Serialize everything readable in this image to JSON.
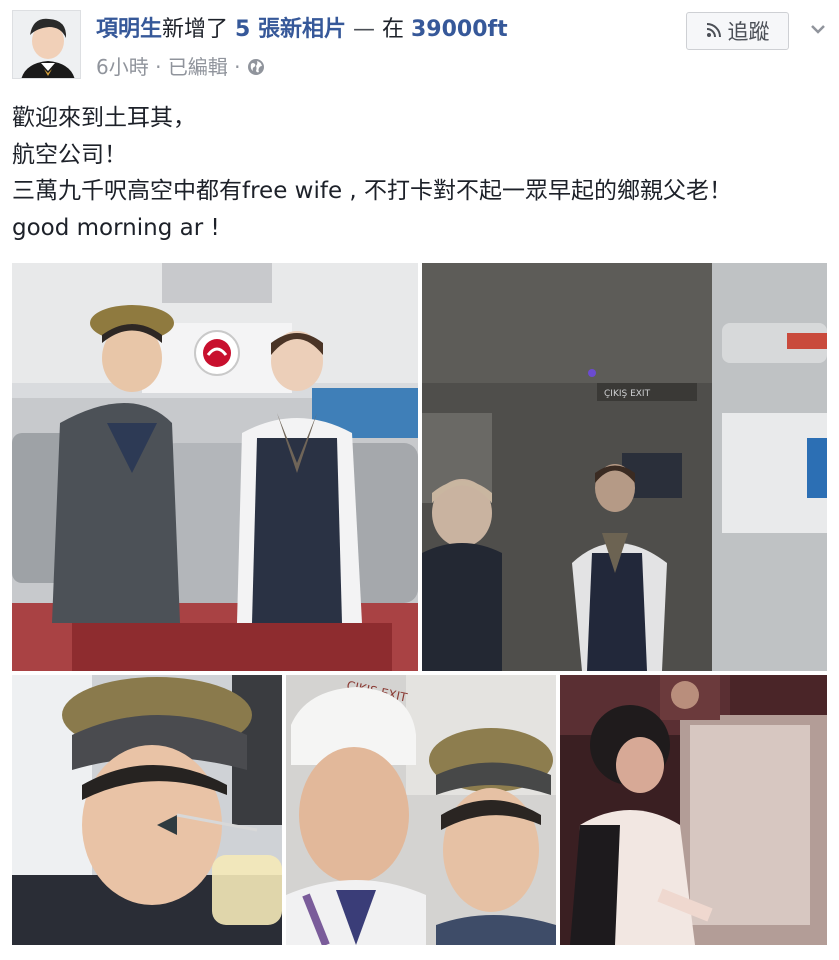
{
  "post": {
    "author": "項明生",
    "verb": "新增了",
    "photo_count_text": "5 張新相片",
    "dash": " — ",
    "at_text": "在 ",
    "place": "39000ft",
    "time": "6小時",
    "sep1": " · ",
    "edited": "已編輯",
    "sep2": " · ",
    "follow_label": "追蹤",
    "message_lines": [
      "歡迎來到土耳其，",
      "航空公司！",
      "三萬九千呎高空中都有free wife , 不打卡對不起一眾早起的鄉親父老！",
      "good morning ar !"
    ]
  },
  "photos": [
    {
      "id": "cabin-portrait",
      "overlay_text": ""
    },
    {
      "id": "galley-crew",
      "overlay_text": "ÇIKIŞ EXIT"
    },
    {
      "id": "selfie-mirror",
      "overlay_text": ""
    },
    {
      "id": "chef-selfie",
      "overlay_text": "ÇIKIŞ EXIT"
    },
    {
      "id": "seat-service",
      "overlay_text": ""
    }
  ],
  "colors": {
    "link": "#365899",
    "text": "#1d2129",
    "meta": "#90949c",
    "button_border": "#ced0d4"
  }
}
